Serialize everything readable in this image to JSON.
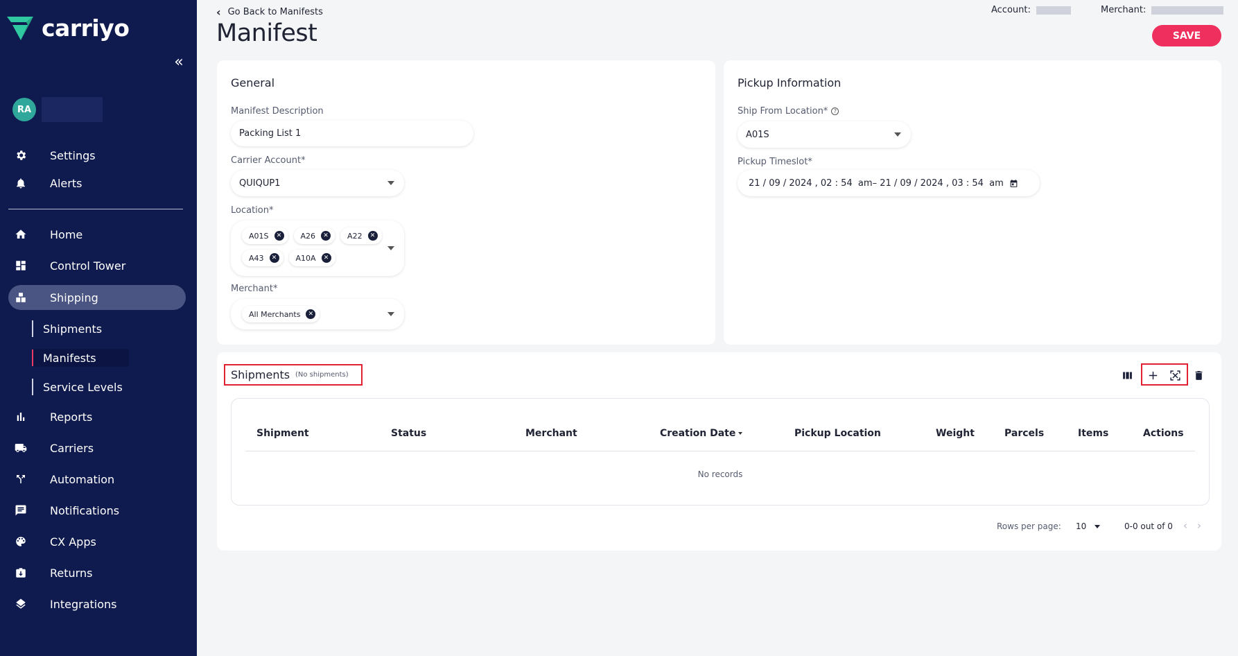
{
  "brand": {
    "name": "carriyo",
    "accent": "#ef2f5d",
    "sidebar_bg": "#0f1a4e"
  },
  "user": {
    "initials": "RA"
  },
  "sidebar": {
    "top_items": [
      {
        "label": "Settings",
        "icon": "gear-icon"
      },
      {
        "label": "Alerts",
        "icon": "bell-icon"
      }
    ],
    "items": [
      {
        "label": "Home",
        "icon": "home-icon"
      },
      {
        "label": "Control Tower",
        "icon": "dashboard-icon"
      },
      {
        "label": "Shipping",
        "icon": "boxes-icon",
        "active": true
      },
      {
        "label": "Reports",
        "icon": "bar-chart-icon"
      },
      {
        "label": "Carriers",
        "icon": "truck-icon"
      },
      {
        "label": "Automation",
        "icon": "split-arrow-icon"
      },
      {
        "label": "Notifications",
        "icon": "chat-icon"
      },
      {
        "label": "CX Apps",
        "icon": "palette-icon"
      },
      {
        "label": "Returns",
        "icon": "return-box-icon"
      },
      {
        "label": "Integrations",
        "icon": "layers-icon"
      }
    ],
    "shipping_sub": [
      {
        "label": "Shipments"
      },
      {
        "label": "Manifests",
        "active": true
      },
      {
        "label": "Service Levels"
      }
    ]
  },
  "header": {
    "back_label": "Go Back to Manifests",
    "title": "Manifest",
    "account_label": "Account:",
    "merchant_label": "Merchant:",
    "save_label": "SAVE"
  },
  "general": {
    "title": "General",
    "description_label": "Manifest Description",
    "description_value": "Packing List 1",
    "carrier_label": "Carrier Account*",
    "carrier_value": "QUIQUP1",
    "location_label": "Location*",
    "locations": [
      "A01S",
      "A26",
      "A22",
      "A43",
      "A10A"
    ],
    "merchant_label": "Merchant*",
    "merchants": [
      "All Merchants"
    ]
  },
  "pickup": {
    "title": "Pickup Information",
    "ship_from_label": "Ship From Location*",
    "ship_from_value": "A01S",
    "timeslot_label": "Pickup Timeslot*",
    "start": {
      "day": "21",
      "month": "09",
      "year": "2024",
      "hour": "02",
      "minute": "54",
      "ampm": "am"
    },
    "end": {
      "day": "21",
      "month": "09",
      "year": "2024",
      "hour": "03",
      "minute": "54",
      "ampm": "am"
    }
  },
  "shipments": {
    "title": "Shipments",
    "subtitle": "(No shipments)",
    "columns": [
      "Shipment",
      "Status",
      "Merchant",
      "Creation Date",
      "Pickup Location",
      "Weight",
      "Parcels",
      "Items",
      "Actions"
    ],
    "empty_text": "No records",
    "rows_per_page_label": "Rows per page:",
    "rows_per_page": "10",
    "range_text": "0-0 out of 0"
  }
}
